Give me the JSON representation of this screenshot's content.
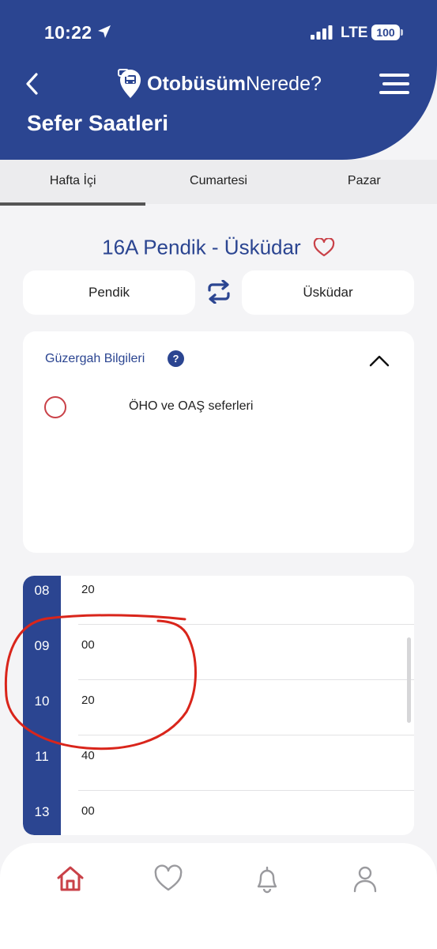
{
  "status_bar": {
    "time": "10:22",
    "network": "LTE",
    "battery": "100"
  },
  "header": {
    "logo_bold": "Otobüsüm",
    "logo_light": "Nerede?",
    "title": "Sefer Saatleri",
    "back_icon": "chevron-left-icon",
    "menu_icon": "hamburger-menu-icon"
  },
  "tabs": [
    {
      "label": "Hafta İçi",
      "active": true
    },
    {
      "label": "Cumartesi",
      "active": false
    },
    {
      "label": "Pazar",
      "active": false
    }
  ],
  "route": {
    "title": "16A Pendik - Üsküdar",
    "favorite_icon": "heart-outline-icon"
  },
  "direction": {
    "from": "Pendik",
    "to": "Üsküdar",
    "swap_icon": "swap-arrows-icon"
  },
  "route_info": {
    "title": "Güzergah Bilgileri",
    "help": "?",
    "option_label": "ÖHO ve OAŞ seferleri"
  },
  "schedule": {
    "rows": [
      {
        "hour": "08",
        "minute": "20"
      },
      {
        "hour": "09",
        "minute": "00"
      },
      {
        "hour": "10",
        "minute": "20"
      },
      {
        "hour": "11",
        "minute": "40"
      },
      {
        "hour": "13",
        "minute": "00"
      }
    ]
  },
  "bottom_nav": [
    {
      "name": "home-icon",
      "active": true
    },
    {
      "name": "favorites-icon",
      "active": false
    },
    {
      "name": "notifications-icon",
      "active": false
    },
    {
      "name": "profile-icon",
      "active": false
    }
  ],
  "colors": {
    "primary": "#2b4591",
    "accent_red": "#c94148",
    "background": "#f4f4f6",
    "annotation": "#d9251b"
  }
}
